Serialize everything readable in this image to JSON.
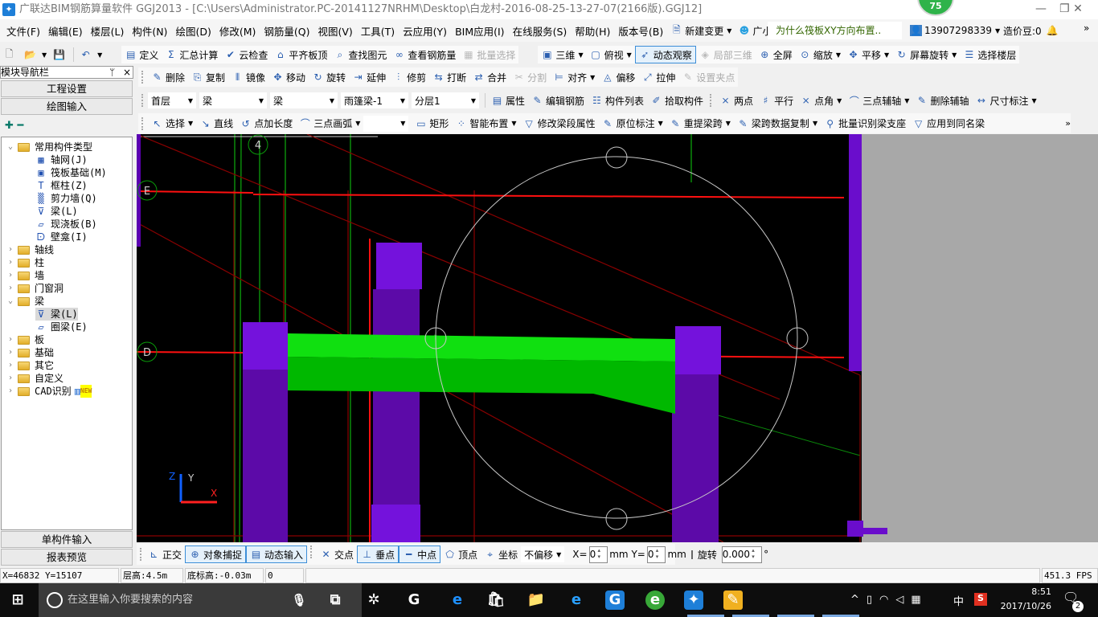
{
  "window": {
    "logo": "✦",
    "title": "广联达BIM钢筋算量软件 GGJ2013 - [C:\\Users\\Administrator.PC-20141127NRHM\\Desktop\\白龙村-2016-08-25-13-27-07(2166版).GGJ12]",
    "badge": "75",
    "minimize": "—",
    "restore": "❐",
    "close": "✕"
  },
  "menu": [
    "文件(F)",
    "编辑(E)",
    "楼层(L)",
    "构件(N)",
    "绘图(D)",
    "修改(M)",
    "钢筋量(Q)",
    "视图(V)",
    "工具(T)",
    "云应用(Y)",
    "BIM应用(I)",
    "在线服务(S)",
    "帮助(H)",
    "版本号(B)"
  ],
  "menu_right": {
    "new_change": "新建变更",
    "assistant": "广小二",
    "tip": "为什么筏板XY方向布置..",
    "user": "13907298339",
    "beans": "造价豆:0",
    "more": "»"
  },
  "toolbar_main": [
    {
      "icon": "▤",
      "label": "定义"
    },
    {
      "icon": "Σ",
      "label": "汇总计算"
    },
    {
      "icon": "✔",
      "label": "云检查"
    },
    {
      "icon": "⌂",
      "label": "平齐板顶"
    },
    {
      "icon": "⌕",
      "label": "查找图元"
    },
    {
      "icon": "∞",
      "label": "查看钢筋量"
    },
    {
      "icon": "▦",
      "label": "批量选择",
      "disabled": true
    }
  ],
  "toolbar_view": [
    {
      "icon": "▣",
      "label": "三维",
      "dropdown": true
    },
    {
      "icon": "▢",
      "label": "俯视",
      "dropdown": true
    },
    {
      "icon": "➶",
      "label": "动态观察",
      "active": true
    },
    {
      "icon": "◈",
      "label": "局部三维",
      "disabled": true
    },
    {
      "icon": "⊕",
      "label": "全屏"
    },
    {
      "icon": "⊙",
      "label": "缩放",
      "dropdown": true
    },
    {
      "icon": "✥",
      "label": "平移",
      "dropdown": true
    },
    {
      "icon": "↻",
      "label": "屏幕旋转",
      "dropdown": true
    },
    {
      "icon": "☰",
      "label": "选择楼层"
    }
  ],
  "toolbar_edit": [
    {
      "icon": "✎",
      "label": "删除"
    },
    {
      "icon": "⎘",
      "label": "复制"
    },
    {
      "icon": "⫴",
      "label": "镜像"
    },
    {
      "icon": "✥",
      "label": "移动"
    },
    {
      "icon": "↻",
      "label": "旋转"
    },
    {
      "icon": "⇥",
      "label": "延伸"
    },
    {
      "icon": "⫶",
      "label": "修剪"
    },
    {
      "icon": "⇆",
      "label": "打断"
    },
    {
      "icon": "⇄",
      "label": "合并"
    },
    {
      "icon": "✂",
      "label": "分割",
      "disabled": true
    },
    {
      "icon": "⊨",
      "label": "对齐",
      "dropdown": true
    },
    {
      "icon": "◬",
      "label": "偏移"
    },
    {
      "icon": "⤢",
      "label": "拉伸"
    },
    {
      "icon": "✎",
      "label": "设置夹点",
      "disabled": true
    }
  ],
  "selectors": [
    {
      "value": "首层"
    },
    {
      "value": "梁"
    },
    {
      "value": "梁"
    },
    {
      "value": "雨篷梁-1"
    },
    {
      "value": "分层1"
    }
  ],
  "toolbar_comp": [
    {
      "icon": "▤",
      "label": "属性"
    },
    {
      "icon": "✎",
      "label": "编辑钢筋"
    },
    {
      "icon": "☷",
      "label": "构件列表"
    },
    {
      "icon": "✐",
      "label": "拾取构件"
    }
  ],
  "toolbar_axis": [
    {
      "icon": "⨯",
      "label": "两点"
    },
    {
      "icon": "♯",
      "label": "平行"
    },
    {
      "icon": "⨯",
      "label": "点角",
      "dropdown": true
    },
    {
      "icon": "⌒",
      "label": "三点辅轴",
      "dropdown": true
    },
    {
      "icon": "✎",
      "label": "删除辅轴"
    },
    {
      "icon": "↔",
      "label": "尺寸标注",
      "dropdown": true
    }
  ],
  "toolbar_draw": [
    {
      "icon": "↖",
      "label": "选择",
      "dropdown": true
    },
    {
      "icon": "↘",
      "label": "直线"
    },
    {
      "icon": "↺",
      "label": "点加长度"
    },
    {
      "icon": "⌒",
      "label": "三点画弧",
      "dropdown": true
    }
  ],
  "toolbar_draw2": [
    {
      "icon": "▭",
      "label": "矩形"
    },
    {
      "icon": "⁘",
      "label": "智能布置",
      "dropdown": true
    },
    {
      "icon": "▽",
      "label": "修改梁段属性"
    },
    {
      "icon": "✎",
      "label": "原位标注",
      "dropdown": true
    },
    {
      "icon": "✎",
      "label": "重提梁跨",
      "dropdown": true
    },
    {
      "icon": "✎",
      "label": "梁跨数据复制",
      "dropdown": true
    },
    {
      "icon": "⚲",
      "label": "批量识别梁支座"
    },
    {
      "icon": "▽",
      "label": "应用到同名梁"
    }
  ],
  "nav": {
    "title": "模块导航栏",
    "pin": "ᛘ",
    "close": "×",
    "project_settings": "工程设置",
    "drawing_input": "绘图输入",
    "expand": "✚",
    "collapse": "━",
    "single_input": "单构件输入",
    "report_preview": "报表预览"
  },
  "tree": {
    "common": "常用构件类型",
    "common_items": [
      {
        "label": "轴网(J)",
        "icon": "▦"
      },
      {
        "label": "筏板基础(M)",
        "icon": "▣"
      },
      {
        "label": "框柱(Z)",
        "icon": "T"
      },
      {
        "label": "剪力墙(Q)",
        "icon": "▒"
      },
      {
        "label": "梁(L)",
        "icon": "⊽"
      },
      {
        "label": "现浇板(B)",
        "icon": "▱"
      },
      {
        "label": "壁龛(I)",
        "icon": "ᗠ"
      }
    ],
    "groups1": [
      "轴线",
      "柱",
      "墙",
      "门窗洞"
    ],
    "beam": "梁",
    "beam_items": [
      {
        "label": "梁(L)",
        "icon": "⊽",
        "selected": true
      },
      {
        "label": "圈梁(E)",
        "icon": "▱"
      }
    ],
    "groups2": [
      "板",
      "基础",
      "其它",
      "自定义",
      "CAD识别"
    ],
    "new_badge": "NEW"
  },
  "canvas": {
    "axis_labels": {
      "top": "4",
      "e": "E",
      "d": "D"
    },
    "ucs": {
      "x": "X",
      "y": "Y",
      "z": "Z"
    },
    "colors": {
      "column": "#6a0dcc",
      "beam": "#00d000",
      "axis_red": "#ff0000",
      "grid_green": "#00a000"
    }
  },
  "snap": {
    "items": [
      {
        "icon": "⊾",
        "label": "正交"
      },
      {
        "icon": "⊕",
        "label": "对象捕捉",
        "active": true
      },
      {
        "icon": "▤",
        "label": "动态输入",
        "active": true
      },
      {
        "icon": "✕",
        "label": "交点"
      },
      {
        "icon": "⊥",
        "label": "垂点",
        "active": true
      },
      {
        "icon": "━",
        "label": "中点",
        "active": true
      },
      {
        "icon": "⬠",
        "label": "顶点"
      },
      {
        "icon": "⌖",
        "label": "坐标"
      }
    ],
    "offset": "不偏移",
    "x_label": "X=",
    "x_value": "0",
    "y_label": "Y=",
    "y_value": "0",
    "unit": "mm",
    "rotate_label": "旋转",
    "rotate_value": "0.000",
    "degree": "°"
  },
  "status": {
    "coords": "X=46832 Y=15107",
    "floor_height": "层高:4.5m",
    "base_height": "底标高:-0.03m",
    "value": "0",
    "fps": "451.3 FPS"
  },
  "taskbar": {
    "search_placeholder": "在这里输入你要搜索的内容",
    "time": "8:51",
    "date": "2017/10/26",
    "ime": "中",
    "notifications": "2"
  }
}
